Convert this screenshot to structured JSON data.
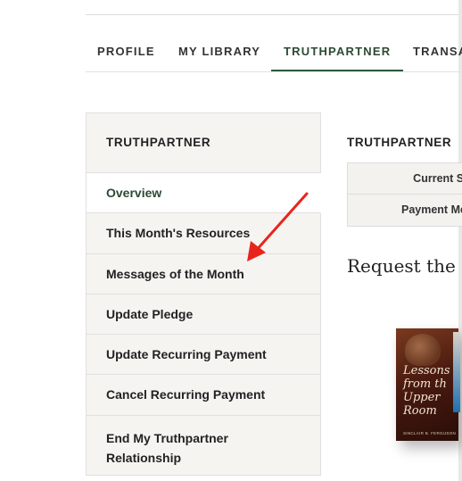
{
  "tabs": [
    {
      "label": "PROFILE"
    },
    {
      "label": "MY LIBRARY"
    },
    {
      "label": "TRUTHPARTNER",
      "active": true
    },
    {
      "label": "TRANSA"
    }
  ],
  "sidebar": {
    "title": "TRUTHPARTNER",
    "items": [
      {
        "label": "Overview",
        "active": true
      },
      {
        "label": "This Month's Resources"
      },
      {
        "label": "Messages of the Month"
      },
      {
        "label": "Update Pledge"
      },
      {
        "label": "Update Recurring Payment"
      },
      {
        "label": "Cancel Recurring Payment"
      },
      {
        "label_line1": "End My Truthpartner",
        "label_line2": "Relationship"
      }
    ]
  },
  "main": {
    "title": "TRUTHPARTNER",
    "status_rows": [
      {
        "label": "Current Status"
      },
      {
        "label": "Payment Method"
      }
    ],
    "request_heading": "Request the",
    "book": {
      "title_line1": "Lessons",
      "title_line2": "from th",
      "title_line3": "Upper",
      "title_line4": "Room",
      "author": "SINCLAIR B. FERGUSON"
    }
  },
  "annotation": {
    "arrow_color": "#e8251c",
    "arrow_icon": "red-arrow-icon"
  },
  "colors": {
    "accent": "#2e5a3a",
    "sidebar_bg": "#f5f4f1"
  }
}
